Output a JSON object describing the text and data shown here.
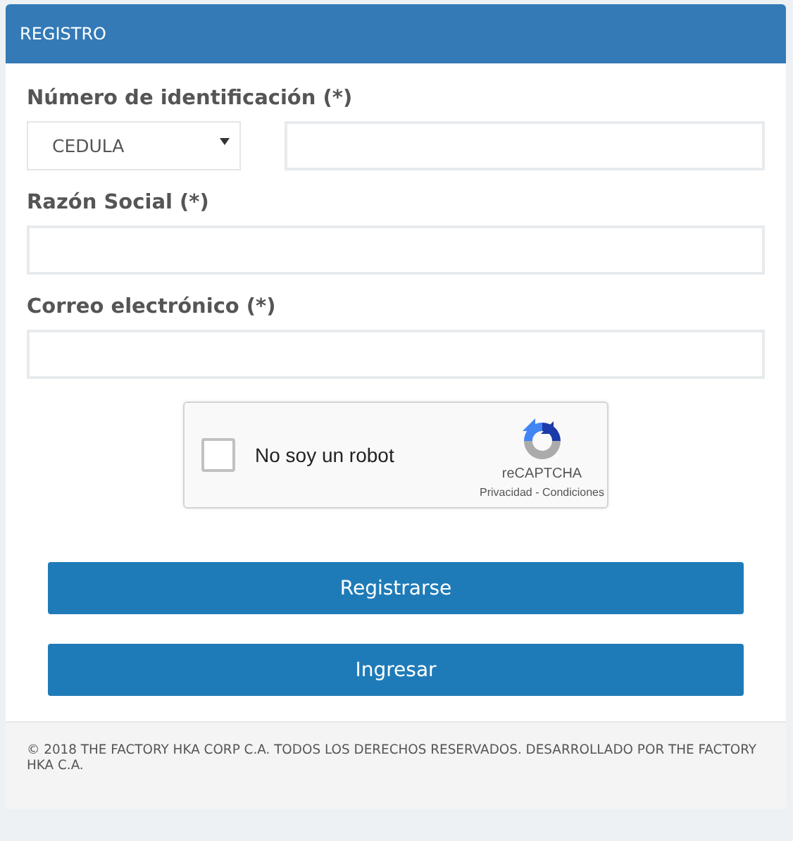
{
  "panel": {
    "title": "REGISTRO"
  },
  "fields": [
    {
      "label": "Número de identificación (*)",
      "kind": "select-input",
      "select_value": "CEDULA"
    },
    {
      "label": "Razón Social (*)",
      "kind": "input"
    },
    {
      "label": "Correo electrónico (*)",
      "kind": "input"
    }
  ],
  "captcha": {
    "label": "No soy un robot",
    "checked": false,
    "brand": "reCAPTCHA",
    "links": "Privacidad - Condiciones"
  },
  "buttons": [
    "Registrarse",
    "Ingresar"
  ],
  "footer": "© 2018 THE FACTORY HKA CORP C.A. TODOS LOS DERECHOS RESERVADOS. DESARROLLADO POR THE FACTORY HKA C.A."
}
